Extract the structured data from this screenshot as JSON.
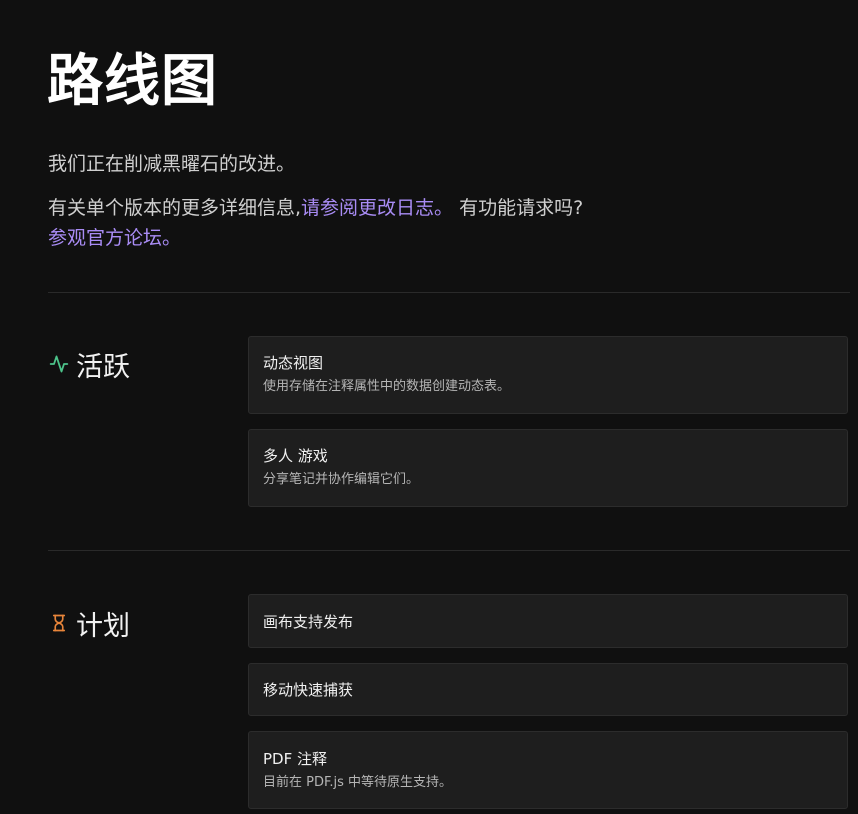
{
  "page": {
    "title": "路线图",
    "intro": "我们正在削减黑曜石的改进。",
    "para_prefix": "有关单个版本的更多详细信息,",
    "changelog_link": "请参阅更改日志。",
    "para_middle": "有功能请求吗?",
    "forum_link": "参观官方论坛。"
  },
  "sections": {
    "active": {
      "label": "活跃",
      "icon": "activity-icon",
      "icon_color": "#4cc38a",
      "items": [
        {
          "title": "动态视图",
          "desc": "使用存储在注释属性中的数据创建动态表。"
        },
        {
          "title": "多人 游戏",
          "desc": "分享笔记并协作编辑它们。"
        }
      ]
    },
    "planned": {
      "label": "计划",
      "icon": "hourglass-icon",
      "icon_color": "#e8853a",
      "items": [
        {
          "title": "画布支持发布"
        },
        {
          "title": "移动快速捕获"
        },
        {
          "title": "PDF 注释",
          "desc": "目前在 PDF.js 中等待原生支持。"
        }
      ]
    }
  },
  "colors": {
    "background": "#101010",
    "card": "#1e1e1e",
    "link": "#a98cf5"
  }
}
